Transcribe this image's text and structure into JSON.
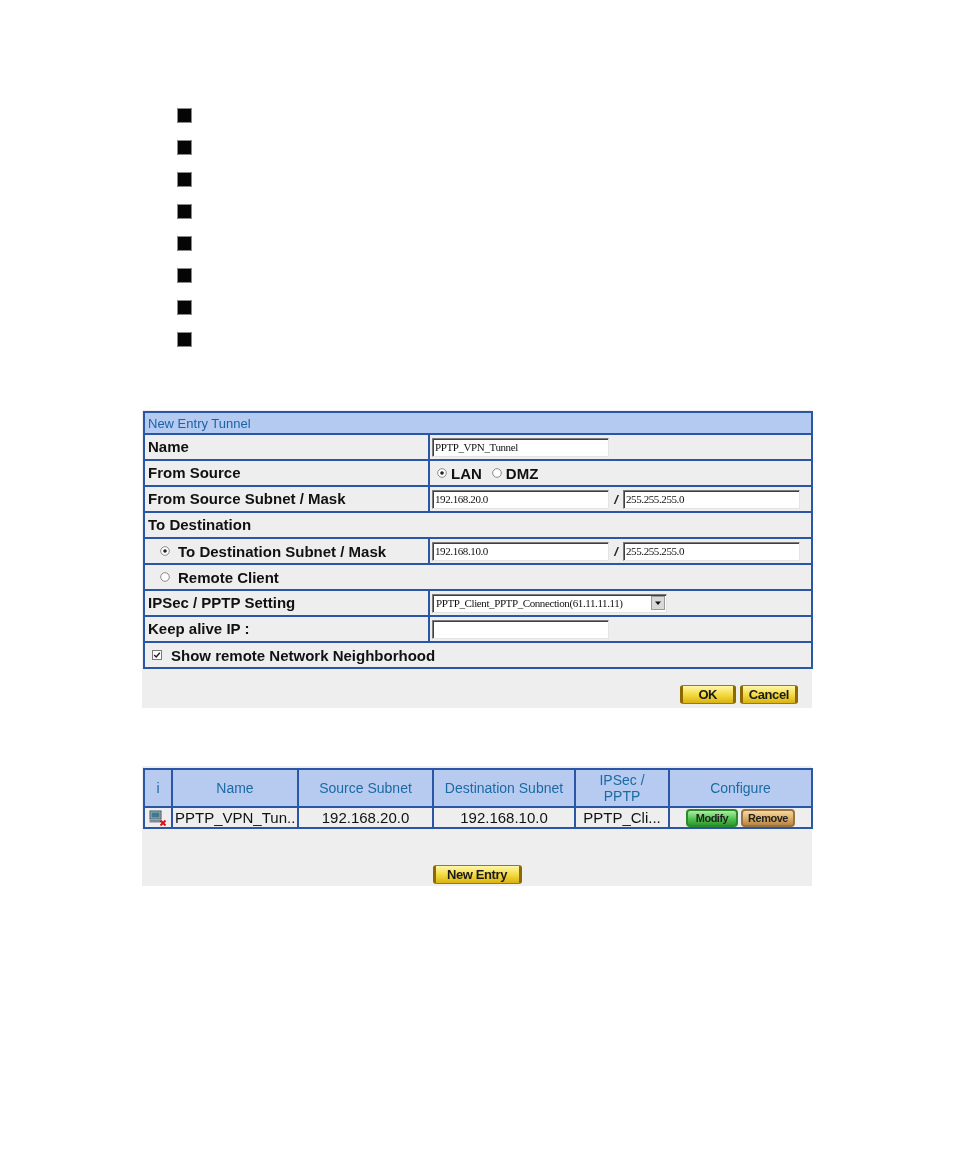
{
  "bullets": [
    {
      "kind": "square"
    },
    {
      "kind": "square"
    },
    {
      "kind": "square"
    },
    {
      "kind": "square"
    },
    {
      "kind": "square"
    },
    {
      "kind": "square"
    },
    {
      "kind": "square"
    },
    {
      "kind": "square"
    }
  ],
  "tunnel_form": {
    "title": "New Entry Tunnel",
    "rows": [
      {
        "kind": "text",
        "label": "Name",
        "value": "PPTP_VPN_Tunnel"
      },
      {
        "kind": "radios",
        "label": "From Source",
        "options": [
          {
            "label": "LAN",
            "selected": true
          },
          {
            "label": "DMZ",
            "selected": false
          }
        ]
      },
      {
        "kind": "subnet",
        "label": "From Source Subnet / Mask",
        "subnet": "192.168.20.0",
        "separator": "/",
        "mask": "255.255.255.0"
      },
      {
        "kind": "heading",
        "label": "To Destination"
      },
      {
        "kind": "radio_subnet",
        "label": "To Destination Subnet / Mask",
        "selected": true,
        "subnet": "192.168.10.0",
        "separator": "/",
        "mask": "255.255.255.0"
      },
      {
        "kind": "radio",
        "label": "Remote Client",
        "selected": false
      },
      {
        "kind": "select",
        "label": "IPSec / PPTP Setting",
        "value": "PPTP_Client_PPTP_Connection(61.11.11.11)"
      },
      {
        "kind": "text",
        "label": "Keep alive IP :"
      },
      {
        "kind": "checkbox",
        "label": "Show remote Network Neighborhood",
        "checked": true
      }
    ],
    "buttons": [
      "OK",
      "Cancel"
    ]
  },
  "tunnel_table": {
    "columns": [
      "i",
      "Name",
      "Source Subnet",
      "Destination Subnet",
      "IPSec / PPTP",
      "Configure"
    ],
    "rows": [
      {
        "cells": [
          {
            "kind": "status_icon"
          },
          {
            "kind": "text",
            "text": "PPTP_VPN_Tun.."
          },
          {
            "kind": "text",
            "text": "192.168.20.0"
          },
          {
            "kind": "text",
            "text": "192.168.10.0"
          },
          {
            "kind": "text",
            "text": "PPTP_Cli..."
          },
          {
            "kind": "buttons",
            "buttons": [
              "Modify",
              "Remove"
            ]
          }
        ]
      }
    ],
    "buttons": [
      "New Entry"
    ]
  }
}
